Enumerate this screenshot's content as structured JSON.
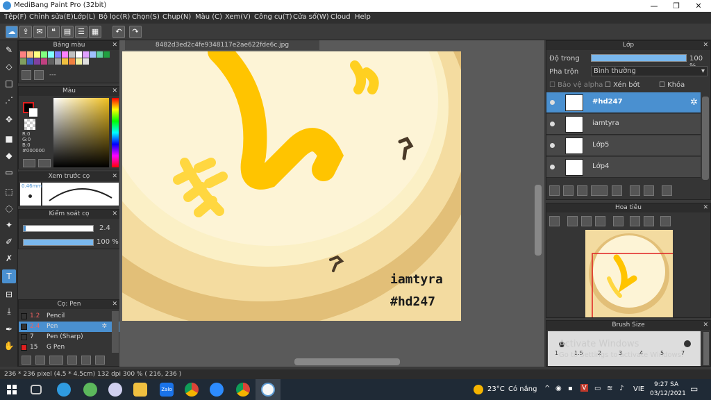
{
  "window": {
    "title": "MediBang Paint Pro (32bit)"
  },
  "menu": [
    "Tệp(F)",
    "Chỉnh sửa(E)",
    "Lớp(L)",
    "Bộ lọc(R)",
    "Chọn(S)",
    "Chụp(N)",
    "Màu (C)",
    "Xem(V)",
    "Công cụ(T)",
    "Cửa sổ(W)",
    "Cloud",
    "Help"
  ],
  "document": {
    "tab": "8482d3ed2c4fe9348117e2ae622fde6c.jpg",
    "text1": "iamtyra",
    "text2": "#hd247"
  },
  "palette": {
    "title": "Bảng màu",
    "row_label": "---"
  },
  "color": {
    "title": "Màu",
    "r": "R:0",
    "g": "G:0",
    "b": "B:0",
    "hex": "#000000"
  },
  "brush_preview": {
    "title": "Xem trước cọ",
    "size": "0.46mm"
  },
  "brush_control": {
    "title": "Kiểm soát cọ",
    "size_value": "2.4",
    "opacity_value": "100 %"
  },
  "brushes": {
    "title": "Cọ: Pen",
    "items": [
      {
        "size": "1.2",
        "name": "Pencil",
        "color": "#333"
      },
      {
        "size": "2.4",
        "name": "Pen",
        "color": "#333",
        "selected": true
      },
      {
        "size": "7",
        "name": "Pen (Sharp)",
        "color": "#333"
      },
      {
        "size": "15",
        "name": "G Pen",
        "color": "#e02020"
      }
    ]
  },
  "layers": {
    "title": "Lớp",
    "opacity_label": "Độ trong",
    "opacity_value": "100 %",
    "blend_label": "Pha trộn",
    "blend_value": "Bình thường",
    "protect_alpha": "Bảo vệ alpha",
    "clip": "Xén bớt",
    "lock": "Khóa",
    "items": [
      {
        "name": "#hd247",
        "selected": true
      },
      {
        "name": "iamtyra"
      },
      {
        "name": "Lớp5"
      },
      {
        "name": "Lớp4"
      }
    ]
  },
  "navigator": {
    "title": "Hoa tiêu"
  },
  "brush_size": {
    "title": "Brush Size",
    "labels": [
      "1",
      "1.5",
      "2",
      "3",
      "4",
      "5",
      "7"
    ]
  },
  "watermark": {
    "line1": "Activate Windows",
    "line2": "Go to Settings to activate Windows."
  },
  "status": {
    "text": "236 * 236 pixel  (4.5 * 4.5cm)  132 dpi  300 %  ( 216, 236 )"
  },
  "taskbar": {
    "weather_temp": "23°C",
    "weather_text": "Có nắng",
    "lang": "VIE",
    "time": "9:27 SA",
    "date": "03/12/2021"
  },
  "colors": {
    "accent": "#4a90d0",
    "ui_bg": "#353535"
  }
}
